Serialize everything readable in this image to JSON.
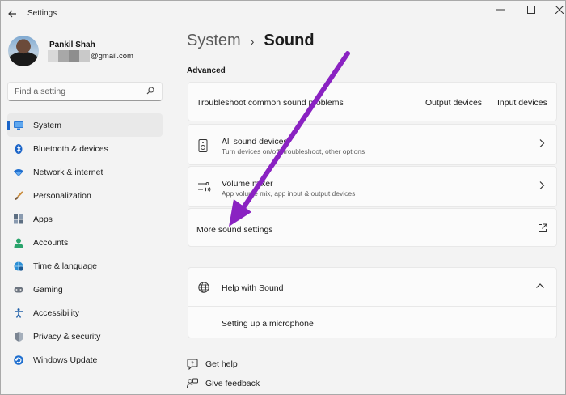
{
  "window": {
    "title": "Settings",
    "controls": {
      "minimize": "—",
      "maximize": "☐",
      "close": "✕"
    }
  },
  "profile": {
    "name": "Pankil Shah",
    "email_visible": "@gmail.com"
  },
  "search": {
    "placeholder": "Find a setting",
    "icon": "search-icon"
  },
  "sidebar": {
    "items": [
      {
        "label": "System",
        "icon": "system-icon",
        "selected": true
      },
      {
        "label": "Bluetooth & devices",
        "icon": "bluetooth-icon"
      },
      {
        "label": "Network & internet",
        "icon": "wifi-icon"
      },
      {
        "label": "Personalization",
        "icon": "brush-icon"
      },
      {
        "label": "Apps",
        "icon": "apps-icon"
      },
      {
        "label": "Accounts",
        "icon": "accounts-icon"
      },
      {
        "label": "Time & language",
        "icon": "globe-clock-icon"
      },
      {
        "label": "Gaming",
        "icon": "gamepad-icon"
      },
      {
        "label": "Accessibility",
        "icon": "accessibility-icon"
      },
      {
        "label": "Privacy & security",
        "icon": "shield-icon"
      },
      {
        "label": "Windows Update",
        "icon": "update-icon"
      }
    ]
  },
  "main": {
    "breadcrumb": {
      "parent": "System",
      "separator": "›",
      "current": "Sound"
    },
    "section": "Advanced",
    "troubleshoot": {
      "label": "Troubleshoot common sound problems",
      "output_link": "Output devices",
      "input_link": "Input devices"
    },
    "all_devices": {
      "title": "All sound devices",
      "subtitle": "Turn devices on/off, troubleshoot, other options"
    },
    "volume_mixer": {
      "title": "Volume mixer",
      "subtitle": "App volume mix, app input & output devices"
    },
    "more_settings": {
      "label": "More sound settings"
    },
    "help": {
      "title": "Help with Sound",
      "link": "Setting up a microphone"
    },
    "footer": {
      "get_help": "Get help",
      "give_feedback": "Give feedback"
    }
  },
  "colors": {
    "accent": "#1a64c8",
    "annotation_arrow": "#8a22c2"
  }
}
